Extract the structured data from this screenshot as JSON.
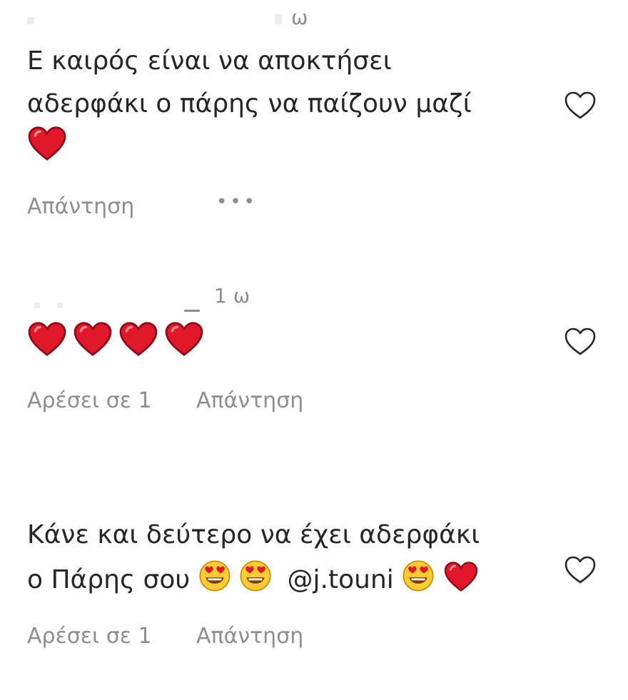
{
  "comments": [
    {
      "time": "ω",
      "lines": [
        "Ε καιρός είναι να αποκτήσει",
        "αδερφάκι ο πάρης να παίζουν μαζί"
      ],
      "reply_label": "Απάντηση",
      "more_label": "•••"
    },
    {
      "time": "1 ω",
      "likes_label": "Αρέσει σε 1",
      "reply_label": "Απάντηση"
    },
    {
      "lines": [
        "Κάνε και δεύτερο να έχει αδερφάκι",
        "ο Πάρης σου"
      ],
      "mention": "@j.touni",
      "likes_label": "Αρέσει σε 1",
      "reply_label": "Απάντηση"
    }
  ],
  "icons": {
    "like": "heart-outline-icon",
    "red_heart": "red-heart-emoji",
    "heart_eyes": "heart-eyes-emoji"
  },
  "colors": {
    "text": "#262626",
    "secondary": "#8e8e8e",
    "heart": "#e0182a"
  }
}
